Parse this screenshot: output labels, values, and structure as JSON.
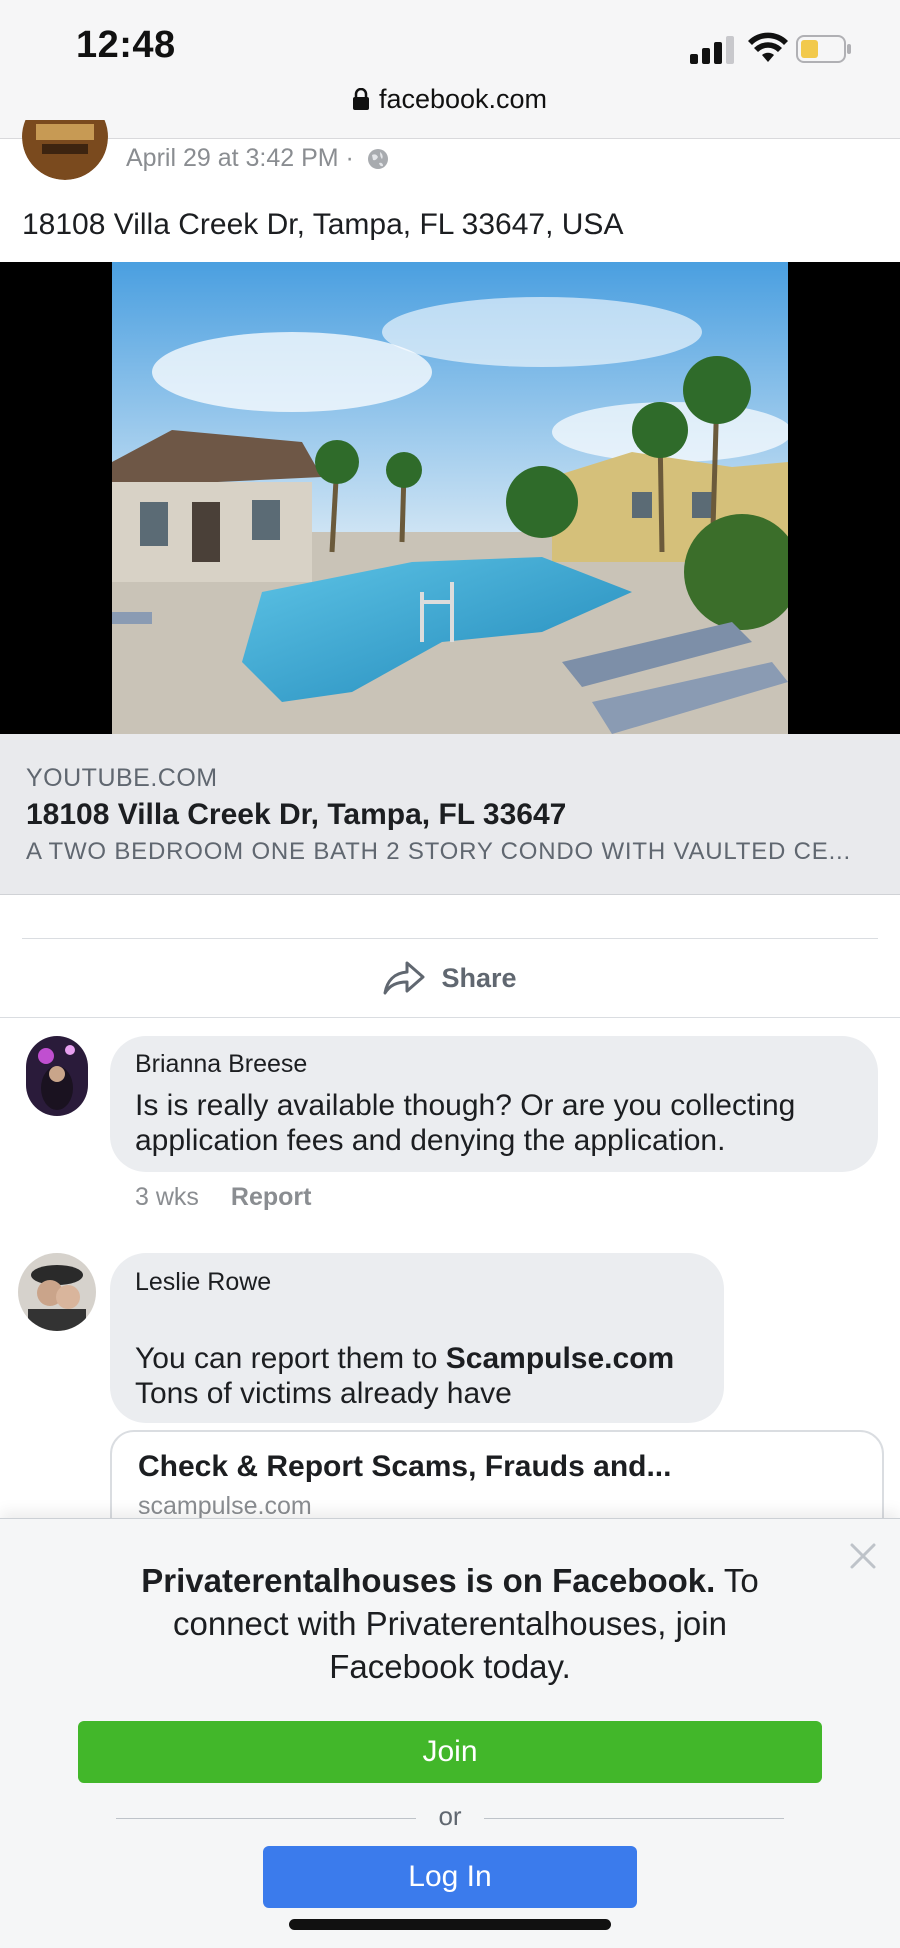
{
  "status_bar": {
    "time": "12:48",
    "url": "facebook.com"
  },
  "post": {
    "timestamp": "April 29 at 3:42 PM ·",
    "text": "18108 Villa Creek Dr, Tampa, FL 33647, USA",
    "link": {
      "domain": "YOUTUBE.COM",
      "title": "18108 Villa Creek Dr, Tampa, FL 33647",
      "description": "A TWO BEDROOM ONE BATH 2 STORY CONDO WITH VAULTED CE..."
    },
    "share_label": "Share"
  },
  "comments": [
    {
      "name": "Brianna Breese",
      "text_line1": "Is is really available though? Or are you collecting",
      "text_line2": "application fees and denying the application.",
      "age": "3 wks",
      "report_label": "Report"
    },
    {
      "name": "Leslie Rowe",
      "text_prefix": "You can report them to ",
      "text_link": "Scampulse.com",
      "text_line2": "Tons of victims already have",
      "preview_title": "Check & Report Scams, Frauds and...",
      "preview_domain": "scampulse.com"
    }
  ],
  "join_prompt": {
    "bold": "Privaterentalhouses is on Facebook.",
    "rest_1": " To",
    "line2": "connect with Privaterentalhouses, join",
    "line3": "Facebook today.",
    "join_label": "Join",
    "or_label": "or",
    "login_label": "Log In"
  },
  "colors": {
    "join_green": "#42b72a",
    "login_blue": "#3b7bec",
    "bubble_gray": "#ebedf0"
  }
}
